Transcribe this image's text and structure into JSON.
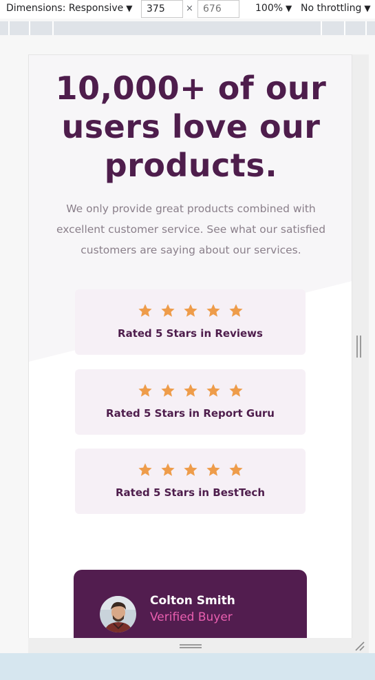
{
  "devtools": {
    "dimensions_label": "Dimensions: Responsive",
    "width_value": "375",
    "height_placeholder": "676",
    "times_sign": "×",
    "zoom_label": "100%",
    "throttle_label": "No throttling",
    "caret": "▼"
  },
  "hero": {
    "headline_line1": "10,000+ of our",
    "headline_line2": "users love our",
    "headline_line3": "products.",
    "intro_line1": "We only provide great products combined with",
    "intro_line2": "excellent customer service. See what our satisfied",
    "intro_line3": "customers are saying about our services."
  },
  "ratings": [
    {
      "label": "Rated 5 Stars in Reviews",
      "stars": 5
    },
    {
      "label": "Rated 5 Stars in Report Guru",
      "stars": 5
    },
    {
      "label": "Rated 5 Stars in BestTech",
      "stars": 5
    }
  ],
  "testimonial": {
    "name": "Colton Smith",
    "role": "Verified Buyer"
  },
  "colors": {
    "brand_dark": "#4e1d4c",
    "card_bg": "#f6f0f6",
    "star": "#ee9c4a",
    "accent_pink": "#ea5fb0",
    "testimonial_bg": "#521d4f"
  },
  "icons": {
    "star": "star-icon",
    "avatar": "avatar-photo",
    "resize": "resize-handle-icon"
  }
}
